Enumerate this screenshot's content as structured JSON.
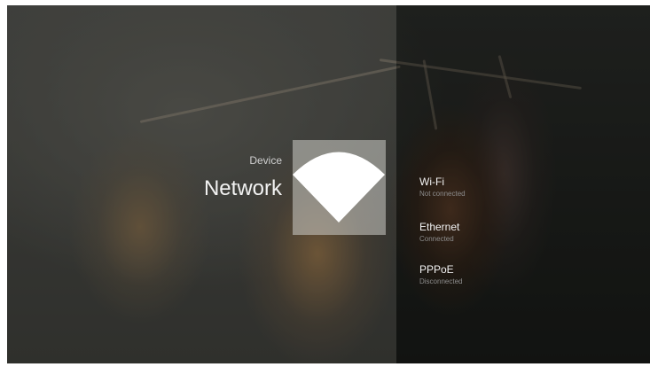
{
  "header": {
    "breadcrumb": "Device",
    "title": "Network"
  },
  "hero_icon": "wifi-icon",
  "menu": {
    "items": [
      {
        "label": "Wi-Fi",
        "status": "Not connected"
      },
      {
        "label": "Ethernet",
        "status": "Connected"
      },
      {
        "label": "PPPoE",
        "status": "Disconnected"
      }
    ]
  },
  "colors": {
    "text_primary": "#f2f2f2",
    "text_secondary": "#8c8c8c",
    "icon_tile": "#cdcdc8",
    "icon": "#ffffff"
  }
}
